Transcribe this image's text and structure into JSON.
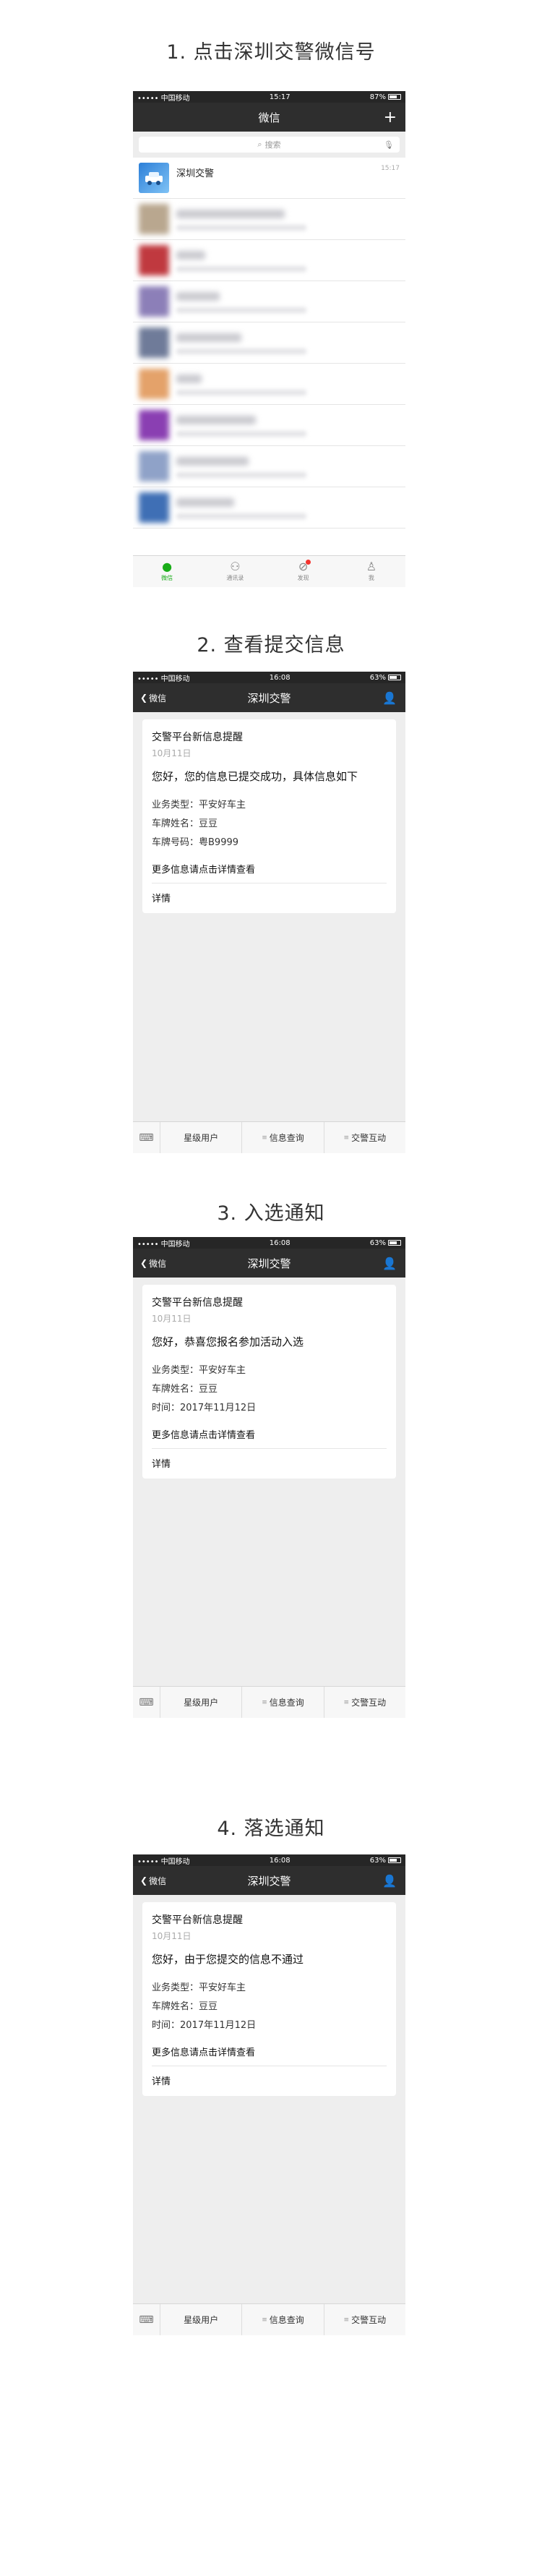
{
  "steps": [
    {
      "title": "1. 点击深圳交警微信号"
    },
    {
      "title": "2. 查看提交信息"
    },
    {
      "title": "3. 入选通知"
    },
    {
      "title": "4. 落选通知"
    }
  ],
  "status": {
    "screen1": {
      "carrier": "••••• 中国移动",
      "time": "15:17",
      "battery": "87%"
    },
    "screen2": {
      "carrier": "••••• 中国移动",
      "time": "16:08",
      "battery": "63%"
    }
  },
  "chat_screen": {
    "title": "微信",
    "add_icon": "plus-icon",
    "search_placeholder": "搜索",
    "first_chat": {
      "name": "深圳交警",
      "time": "15:17"
    },
    "tabs": [
      {
        "label": "微信",
        "icon": "chat-bubble-icon"
      },
      {
        "label": "通讯录",
        "icon": "contacts-icon"
      },
      {
        "label": "发现",
        "icon": "compass-icon"
      },
      {
        "label": "我",
        "icon": "person-icon"
      }
    ]
  },
  "message_screen": {
    "back_label": "微信",
    "title": "深圳交警",
    "menu": [
      "星级用户",
      "信息查询",
      "交警互动"
    ]
  },
  "cards": {
    "submitted": {
      "title": "交警平台新信息提醒",
      "date": "10月11日",
      "lead": "您好，您的信息已提交成功，具体信息如下",
      "fields": [
        "业务类型：平安好车主",
        "车牌姓名：豆豆",
        "车牌号码：粤B9999"
      ],
      "more": "更多信息请点击详情查看",
      "detail": "详情"
    },
    "selected": {
      "title": "交警平台新信息提醒",
      "date": "10月11日",
      "lead": "您好，恭喜您报名参加活动入选",
      "fields": [
        "业务类型：平安好车主",
        "车牌姓名：豆豆",
        "时间：2017年11月12日"
      ],
      "more": "更多信息请点击详情查看",
      "detail": "详情"
    },
    "rejected": {
      "title": "交警平台新信息提醒",
      "date": "10月11日",
      "lead": "您好，由于您提交的信息不通过",
      "fields": [
        "业务类型：平安好车主",
        "车牌姓名：豆豆",
        "时间：2017年11月12日"
      ],
      "more": "更多信息请点击详情查看",
      "detail": "详情"
    }
  },
  "colors": {
    "nav_bg": "#2e2e2e",
    "wechat_green": "#1aad19",
    "page_bg": "#eeeeee"
  }
}
